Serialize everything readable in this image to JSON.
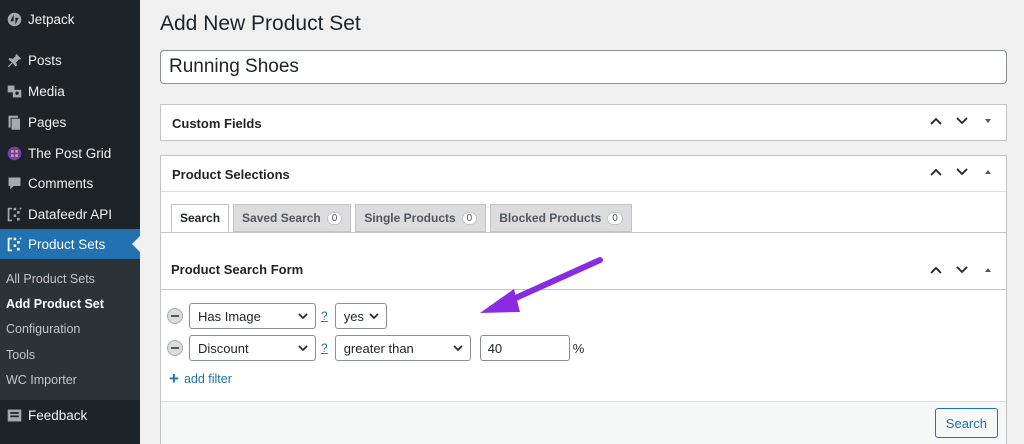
{
  "sidebar": {
    "items": [
      {
        "label": "Jetpack",
        "icon": "jetpack-icon"
      },
      {
        "label": "Posts",
        "icon": "pin-icon"
      },
      {
        "label": "Media",
        "icon": "media-icon"
      },
      {
        "label": "Pages",
        "icon": "pages-icon"
      },
      {
        "label": "The Post Grid",
        "icon": "post-grid-icon"
      },
      {
        "label": "Comments",
        "icon": "comment-icon"
      },
      {
        "label": "Datafeedr API",
        "icon": "datafeedr-icon"
      },
      {
        "label": "Product Sets",
        "icon": "product-sets-icon",
        "current": true
      },
      {
        "label": "Feedback",
        "icon": "feedback-icon"
      }
    ],
    "submenu": [
      {
        "label": "All Product Sets"
      },
      {
        "label": "Add Product Set",
        "current": true
      },
      {
        "label": "Configuration"
      },
      {
        "label": "Tools"
      },
      {
        "label": "WC Importer"
      }
    ]
  },
  "main": {
    "title": "Add New Product Set",
    "title_value": "Running Shoes",
    "custom_fields": {
      "title": "Custom Fields"
    },
    "product_selections": {
      "title": "Product Selections",
      "tabs": [
        {
          "label": "Search",
          "active": true
        },
        {
          "label": "Saved Search",
          "count": "0"
        },
        {
          "label": "Single Products",
          "count": "0"
        },
        {
          "label": "Blocked Products",
          "count": "0"
        }
      ],
      "search_form": {
        "title": "Product Search Form",
        "filters": [
          {
            "field": "Has Image",
            "help": "?",
            "operator": "yes"
          },
          {
            "field": "Discount",
            "help": "?",
            "operator": "greater than",
            "value": "40",
            "unit": "%"
          }
        ],
        "add_filter": "add filter",
        "plus": "+",
        "search_button": "Search"
      }
    }
  },
  "colors": {
    "accent": "#2271b1",
    "sidebar": "#1d2327",
    "annotation_arrow": "#8a2be2"
  }
}
